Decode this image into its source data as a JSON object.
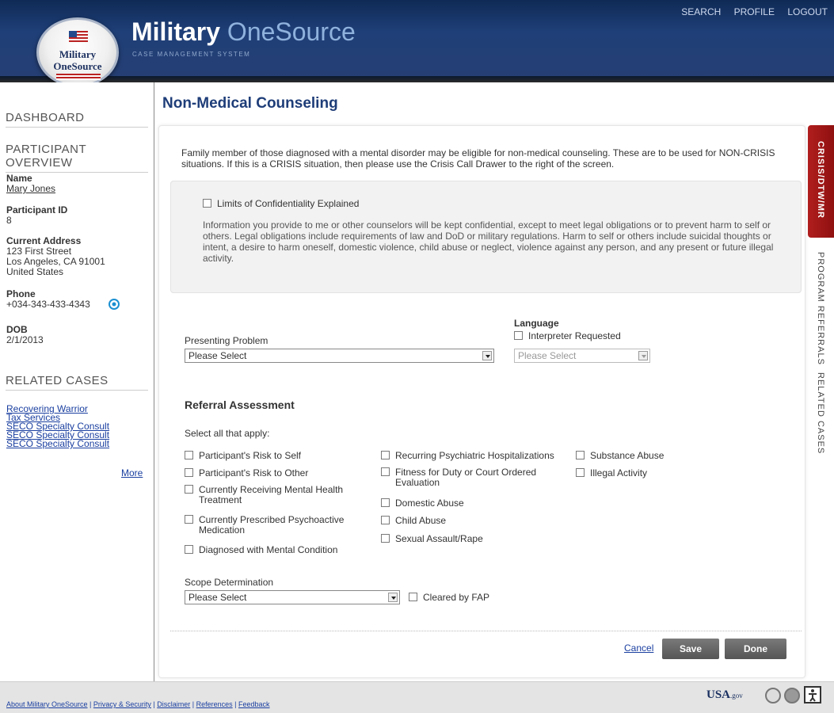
{
  "header": {
    "brand_bold": "Military",
    "brand_light": " OneSource",
    "brand_sub": "CASE MANAGEMENT SYSTEM",
    "seal_line1": "Military",
    "seal_line2": "OneSource",
    "nav": [
      "SEARCH",
      "PROFILE",
      "LOGOUT"
    ]
  },
  "sidebar": {
    "dashboard": "DASHBOARD",
    "overview_title": "PARTICIPANT OVERVIEW",
    "name_label": "Name",
    "name_value": "Mary Jones",
    "id_label": "Participant ID",
    "id_value": "8",
    "address_label": "Current Address",
    "address_line1": "123 First Street",
    "address_line2": "Los Angeles,  CA 91001",
    "address_line3": "United States",
    "phone_label": "Phone",
    "phone_value": "+034-343-433-4343",
    "dob_label": "DOB",
    "dob_value": "2/1/2013",
    "related_title": "RELATED CASES",
    "related_cases": [
      "Recovering Warrior",
      "Tax Services",
      "SECO Specialty Consult",
      "SECO Specialty Consult",
      "SECO Specialty Consult"
    ],
    "more": "More"
  },
  "main": {
    "title": "Non-Medical Counseling",
    "intro": "Family member of those diagnosed with a mental disorder may be eligible for non-medical counseling. These are to be used for NON-CRISIS situations. If this is a CRISIS situation, then please use the Crisis Call Drawer to the right of the screen.",
    "confidentiality_label": "Limits of Confidentiality Explained",
    "confidentiality_text": "Information you provide to me or other counselors will be kept confidential, except to meet legal obligations or to prevent harm to self or others. Legal obligations include requirements of law and DoD or military regulations. Harm to self or others include suicidal thoughts or intent, a desire to harm oneself, domestic violence, child abuse or neglect, violence against any person, and any present or future illegal activity.",
    "presenting_problem_label": "Presenting Problem",
    "presenting_problem_value": "Please Select",
    "language_label": "Language",
    "interpreter_label": "Interpreter Requested",
    "language_value": "Please Select",
    "referral_title": "Referral Assessment",
    "select_all": "Select all that apply:",
    "col1": [
      "Participant's Risk to Self",
      "Participant's Risk to Other",
      "Currently Receiving Mental Health Treatment",
      "Currently Prescribed Psychoactive Medication",
      "Diagnosed with Mental Condition"
    ],
    "col2": [
      "Recurring Psychiatric Hospitalizations",
      "Fitness for Duty or Court Ordered Evaluation",
      "Domestic Abuse",
      "Child Abuse",
      "Sexual Assault/Rape"
    ],
    "col3": [
      "Substance Abuse",
      "Illegal Activity"
    ],
    "scope_label": "Scope Determination",
    "scope_value": "Please Select",
    "cleared_label": "Cleared by FAP",
    "cancel": "Cancel",
    "save": "Save",
    "done": "Done"
  },
  "right_tabs": [
    "CRISIS/DTW/MR",
    "PROGRAM REFERRALS",
    "RELATED CASES"
  ],
  "footer": {
    "links": [
      "About Military OneSource",
      "Privacy & Security",
      "Disclaimer",
      "References",
      "Feedback"
    ],
    "usagov": "USA",
    "usagov_suffix": ".gov"
  },
  "colors": {
    "header": "#1f3f78",
    "crisis_tab": "#b11e1e",
    "title": "#1e3d78",
    "link": "#1a3fa0"
  }
}
